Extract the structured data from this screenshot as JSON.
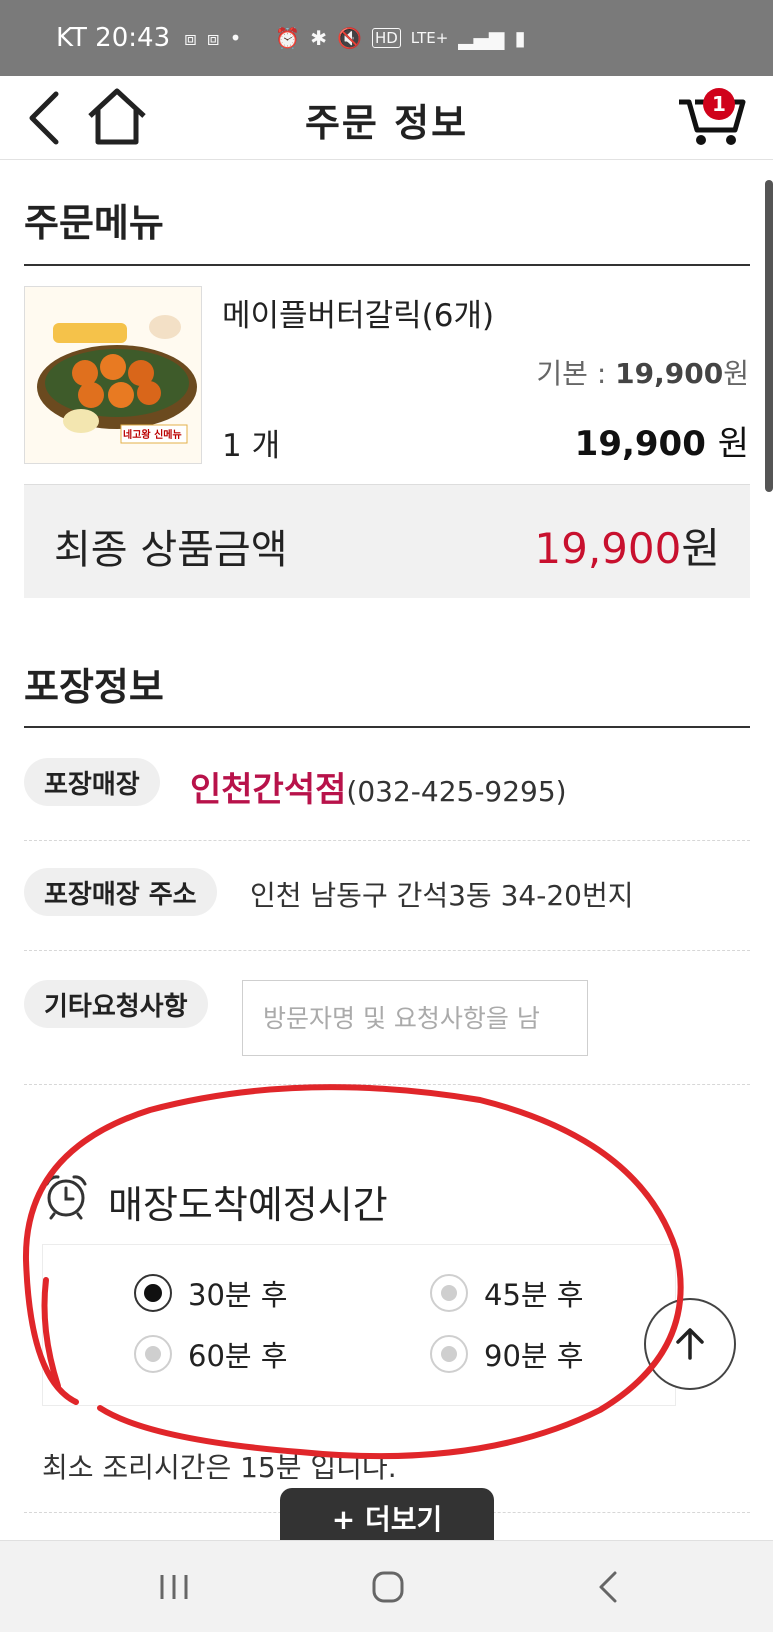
{
  "status_bar": {
    "carrier_time": "KT 20:43",
    "icons": [
      "screenshot-icon",
      "screenshot-icon",
      "dot-icon",
      "alarm-icon",
      "bluetooth-icon",
      "mute-icon",
      "hd-icon",
      "lte-plus-icon",
      "signal-icon",
      "battery-icon"
    ]
  },
  "header": {
    "title": "주문 정보",
    "cart_count": "1"
  },
  "order_menu": {
    "title": "주문메뉴",
    "item": {
      "name": "메이플버터갈릭(6개)",
      "base_label": "기본 : ",
      "base_price": "19,900",
      "base_unit": "원",
      "quantity": "1 개",
      "price": "19,900",
      "price_unit": "원",
      "image_text": "네고왕 신메뉴"
    },
    "total_label": "최종 상품금액",
    "total_value": "19,900",
    "total_unit": "원"
  },
  "packaging": {
    "title": "포장정보",
    "store_label": "포장매장",
    "store_name": "인천간석점",
    "store_phone": "(032-425-9295)",
    "address_label": "포장매장 주소",
    "address": "인천 남동구 간석3동 34-20번지",
    "request_label": "기타요청사항",
    "request_placeholder": "방문자명 및 요청사항을 남"
  },
  "eta": {
    "title": "매장도착예정시간",
    "options": [
      {
        "label": "30분 후",
        "selected": true
      },
      {
        "label": "45분 후",
        "selected": false
      },
      {
        "label": "60분 후",
        "selected": false
      },
      {
        "label": "90분 후",
        "selected": false
      }
    ],
    "note": "최소 조리시간은 15분 입니다."
  },
  "more_button": "+ 더보기",
  "colors": {
    "accent_red": "#c8102e",
    "store_name": "#b8124a",
    "badge": "#d0021b",
    "annotation": "#e0262a"
  }
}
